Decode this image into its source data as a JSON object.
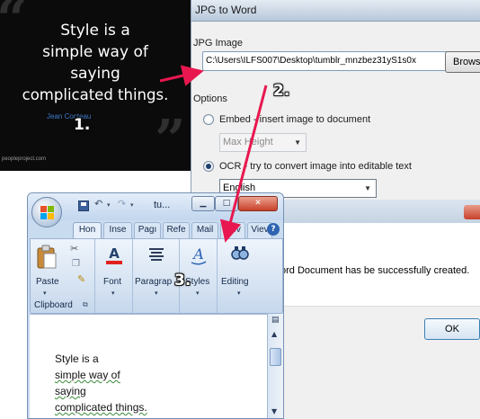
{
  "quote": {
    "lines": [
      "Style is a",
      "simple way of",
      "saying",
      "complicated things."
    ],
    "author": "Jean Cocteau",
    "site": "peopleproject.com"
  },
  "steps": [
    "1.",
    "2.",
    "3."
  ],
  "jpg_window": {
    "title": "JPG to Word",
    "jpg_image_label": "JPG Image",
    "path_value": "C:\\Users\\ILFS007\\Desktop\\tumblr_mnzbez31yS1s0x",
    "browse_label": "Browse",
    "options_label": "Options",
    "embed_label": "Embed - insert image to document",
    "max_height_value": "Max Height",
    "ocr_label": "OCR - try to convert image into editable text",
    "language_value": "English",
    "selected_option": "ocr"
  },
  "success_dialog": {
    "message": "ord Document has be successfully created.",
    "ok_label": "OK"
  },
  "word_window": {
    "title": "tu...",
    "tabs": [
      "Hon",
      "Inse",
      "Pagı",
      "Refe",
      "Mail",
      "Rev",
      "Viev"
    ],
    "active_tab": "Hon",
    "help_label": "?",
    "ribbon": {
      "paste_label": "Paste",
      "clipboard_label": "Clipboard",
      "font_label": "Font",
      "paragraph_label": "Paragrap",
      "styles_label": "Styles",
      "editing_label": "Editing"
    },
    "document_lines": [
      "Style is a",
      "simple way of",
      "saying",
      "complicated things."
    ]
  },
  "colors": {
    "arrow": "#e8174f",
    "quote_background": "#0b0b0b",
    "author": "#3d77c8"
  }
}
